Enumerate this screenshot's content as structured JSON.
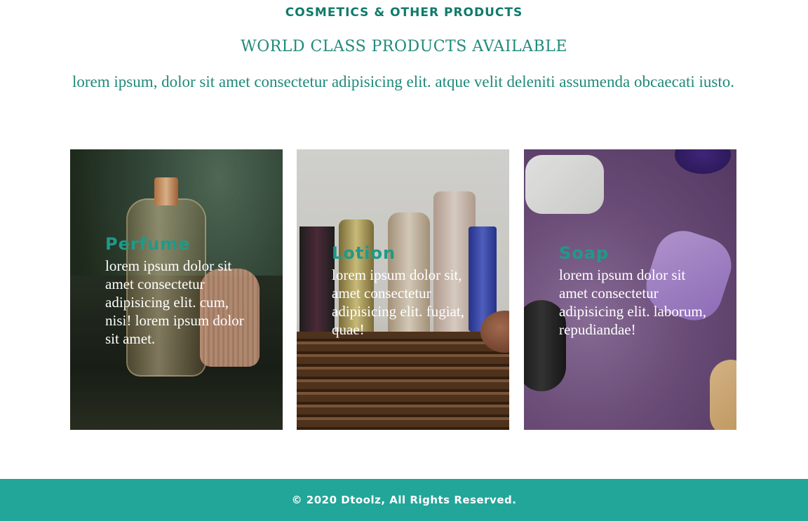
{
  "section": {
    "label": "COSMETICS & OTHER PRODUCTS",
    "title": "WORLD CLASS PRODUCTS AVAILABLE",
    "description": "lorem ipsum, dolor sit amet consectetur adipisicing elit. atque velit deleniti assumenda obcaecati iusto."
  },
  "cards": [
    {
      "title": "Perfume",
      "text": "lorem ipsum dolor sit amet consectetur adipisicing elit. cum, nisi! lorem ipsum dolor sit amet.",
      "image": "perfume-bottle-image"
    },
    {
      "title": "Lotion",
      "text": "lorem ipsum dolor sit, amet consectetur adipisicing elit. fugiat, quae!",
      "image": "lotion-bottles-basket-image"
    },
    {
      "title": "Soap",
      "text": "lorem ipsum dolor sit amet consectetur adipisicing elit. laborum, repudiandae!",
      "image": "soap-bars-image"
    }
  ],
  "footer": {
    "copyright": "© 2020 Dtoolz, All Rights Reserved."
  },
  "colors": {
    "accent": "#1f8a7a",
    "label": "#0f7a6a",
    "footer_bg": "#22a699",
    "card_text": "#ffffff"
  }
}
